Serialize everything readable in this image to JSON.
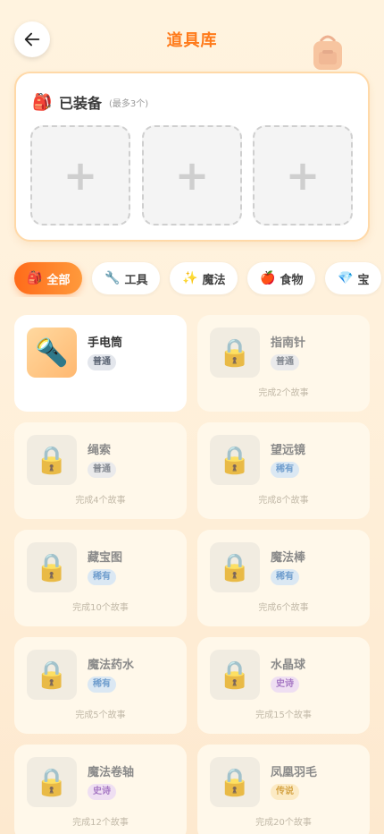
{
  "header": {
    "title": "道具库",
    "back_icon": "arrow-left-icon",
    "decor_icon": "backpack-icon"
  },
  "equipped": {
    "icon": "🎒",
    "title": "已装备",
    "limit": "(最多3个)",
    "slots": [
      "+",
      "+",
      "+"
    ]
  },
  "tabs": [
    {
      "icon": "🎒",
      "label": "全部",
      "active": true
    },
    {
      "icon": "🔧",
      "label": "工具",
      "active": false
    },
    {
      "icon": "✨",
      "label": "魔法",
      "active": false
    },
    {
      "icon": "🍎",
      "label": "食物",
      "active": false
    },
    {
      "icon": "💎",
      "label": "宝",
      "active": false
    }
  ],
  "items": [
    {
      "name": "手电筒",
      "rarity": "普通",
      "icon": "🔦",
      "locked": false,
      "requirement": ""
    },
    {
      "name": "指南针",
      "rarity": "普通",
      "icon": "🔒",
      "locked": true,
      "requirement": "完成2个故事"
    },
    {
      "name": "绳索",
      "rarity": "普通",
      "icon": "🔒",
      "locked": true,
      "requirement": "完成4个故事"
    },
    {
      "name": "望远镜",
      "rarity": "稀有",
      "icon": "🔒",
      "locked": true,
      "requirement": "完成8个故事"
    },
    {
      "name": "藏宝图",
      "rarity": "稀有",
      "icon": "🔒",
      "locked": true,
      "requirement": "完成10个故事"
    },
    {
      "name": "魔法棒",
      "rarity": "稀有",
      "icon": "🔒",
      "locked": true,
      "requirement": "完成6个故事"
    },
    {
      "name": "魔法药水",
      "rarity": "稀有",
      "icon": "🔒",
      "locked": true,
      "requirement": "完成5个故事"
    },
    {
      "name": "水晶球",
      "rarity": "史诗",
      "icon": "🔒",
      "locked": true,
      "requirement": "完成15个故事"
    },
    {
      "name": "魔法卷轴",
      "rarity": "史诗",
      "icon": "🔒",
      "locked": true,
      "requirement": "完成12个故事"
    },
    {
      "name": "凤凰羽毛",
      "rarity": "传说",
      "icon": "🔒",
      "locked": true,
      "requirement": "完成20个故事"
    }
  ],
  "rarity_colors": {
    "普通": {
      "bg": "#e3e6ec",
      "fg": "#5d6675"
    },
    "稀有": {
      "bg": "#cfe3f7",
      "fg": "#3f7fc4"
    },
    "史诗": {
      "bg": "#ead7f5",
      "fg": "#8a4fb8"
    },
    "传说": {
      "bg": "#fbe6b8",
      "fg": "#c98a12"
    }
  },
  "colors": {
    "accent": "#ff7a1a"
  }
}
